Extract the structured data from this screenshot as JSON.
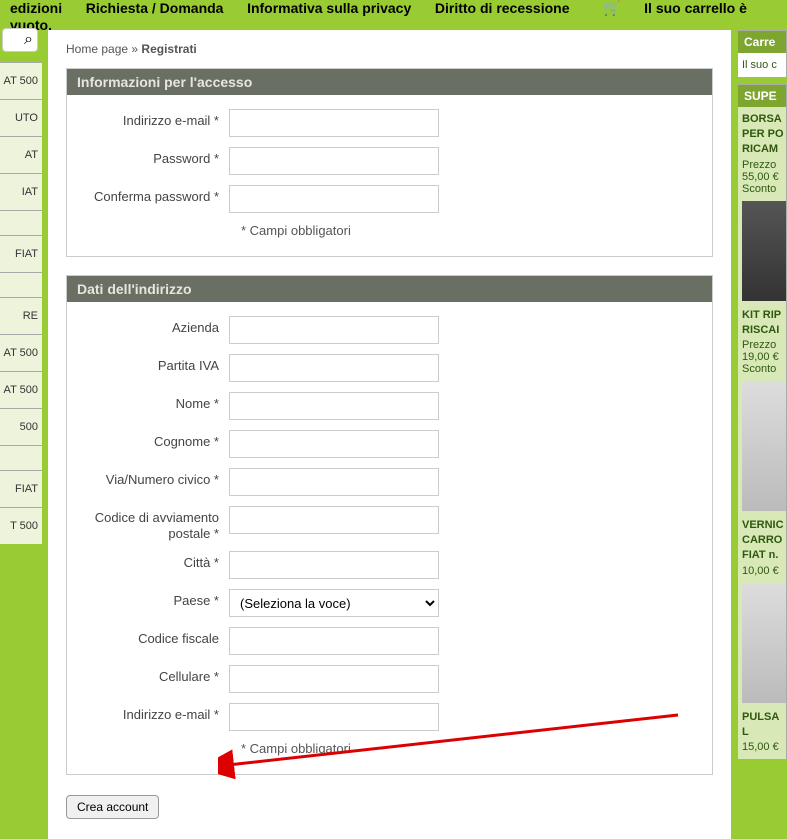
{
  "topnav": {
    "items": [
      "edizioni",
      "Richiesta / Domanda",
      "Informativa sulla privacy",
      "Diritto di recessione"
    ],
    "cart": "Il suo carrello è vuoto."
  },
  "sidebar_left": {
    "categories": [
      "AT 500",
      "UTO",
      "AT",
      "IAT",
      "",
      "FIAT",
      "",
      "RE",
      "AT 500",
      "AT 500",
      "500",
      "",
      "FIAT",
      "T 500"
    ]
  },
  "breadcrumb": {
    "home": "Home page",
    "sep": "»",
    "current": "Registrati"
  },
  "panel1": {
    "title": "Informazioni per l'accesso",
    "email": "Indirizzo e-mail *",
    "password": "Password *",
    "confirm": "Conferma password *",
    "req": "* Campi obbligatori"
  },
  "panel2": {
    "title": "Dati dell'indirizzo",
    "azienda": "Azienda",
    "piva": "Partita IVA",
    "nome": "Nome *",
    "cognome": "Cognome *",
    "via": "Via/Numero civico *",
    "cap": "Codice di avviamento postale *",
    "citta": "Città *",
    "paese": "Paese *",
    "paese_opt": "(Seleziona la voce)",
    "cf": "Codice fiscale",
    "cell": "Cellulare *",
    "email2": "Indirizzo e-mail *",
    "req": "* Campi obbligatori"
  },
  "submit": "Crea account",
  "sidebar_right": {
    "box1": {
      "head": "Carre",
      "body": "Il suo c"
    },
    "box2": {
      "head": "SUPE",
      "p1": {
        "t1": "BORSA",
        "t2": "PER PO",
        "t3": "RICAM",
        "price": "Prezzo",
        "old": "55,00 €",
        "disc": "Sconto"
      },
      "p2": {
        "t1": "KIT RIP",
        "t2": "RISCAI",
        "price": "Prezzo",
        "old": "19,00 €",
        "disc": "Sconto"
      },
      "p3": {
        "t1": "VERNIC",
        "t2": "CARRO",
        "t3": "FIAT n.",
        "old": "10,00 €"
      },
      "p4": {
        "t1": "PULSA",
        "t2": "L",
        "old": "15,00 €"
      }
    }
  }
}
